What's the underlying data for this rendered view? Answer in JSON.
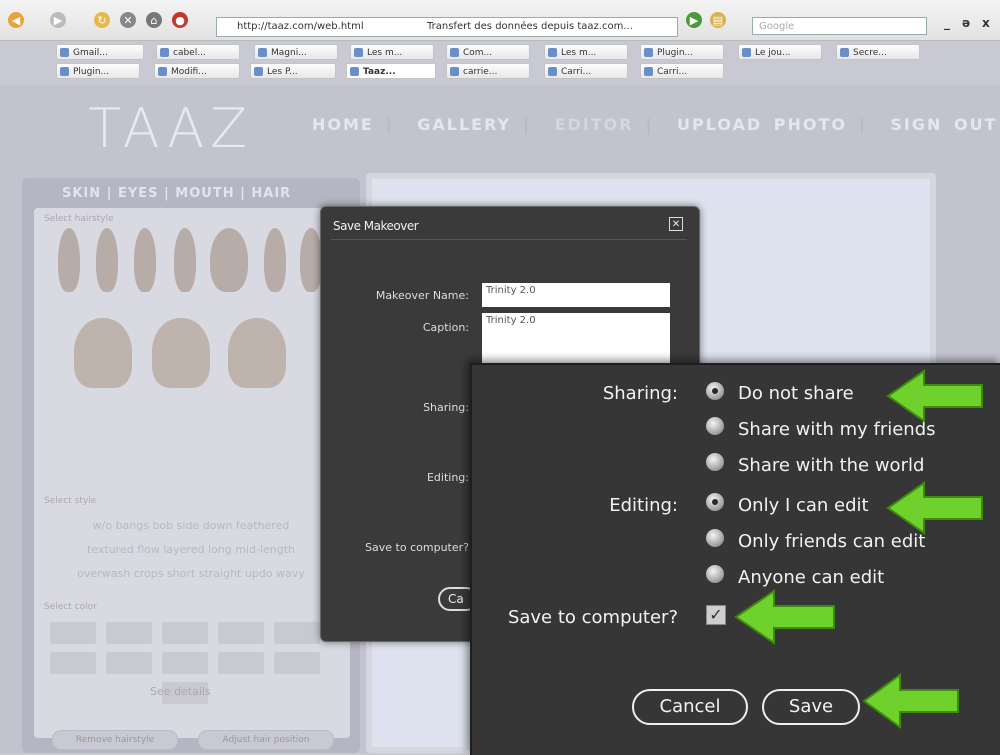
{
  "browser": {
    "url": "http://taaz.com/web.html",
    "status": "Transfert des données depuis taaz.com...",
    "search_placeholder": "Google",
    "win_min": "_",
    "win_max": "ə",
    "win_close": "x",
    "tabs_row1": [
      "Gmail...",
      "cabel...",
      "Magni...",
      "Les m...",
      "Com...",
      "Les m...",
      "Plugin...",
      "Le jou...",
      "Secre..."
    ],
    "tabs_row2": [
      "Plugin...",
      "Modifi...",
      "Les P...",
      "Taaz...",
      "carrie...",
      "Carri...",
      "Carri..."
    ]
  },
  "site": {
    "logo": "TAAZ",
    "nav": [
      "HOME",
      "GALLERY",
      "EDITOR",
      "UPLOAD PHOTO",
      "SIGN OUT"
    ],
    "subtabs": "SKIN | EYES | MOUTH | HAIR",
    "select_hairstyle": "Select hairstyle",
    "select_style": "Select style",
    "style_line1": "w/o bangs   bob   side   down   feathered",
    "style_line2": "textured   flow   layered   long   mid-length",
    "style_line3": "overwash   crops   short   straight   updo   wavy",
    "select_color": "Select color",
    "remove_btn": "Remove hairstyle",
    "adjust_btn": "Adjust hair position",
    "see_results": "See details"
  },
  "dialog": {
    "title": "Save Makeover",
    "close": "✕",
    "name_label": "Makeover Name:",
    "name_value": "Trinity 2.0",
    "caption_label": "Caption:",
    "caption_value": "Trinity 2.0",
    "sharing_label": "Sharing:",
    "editing_label": "Editing:",
    "save_label": "Save to computer?",
    "cancel_partial": "Ca"
  },
  "zoom": {
    "sharing_label": "Sharing:",
    "sharing_options": [
      "Do not share",
      "Share with my friends",
      "Share with the world"
    ],
    "sharing_selected": 0,
    "editing_label": "Editing:",
    "editing_options": [
      "Only I can edit",
      "Only friends can edit",
      "Anyone can edit"
    ],
    "editing_selected": 0,
    "save_label": "Save to computer?",
    "save_checked": true,
    "check_mark": "✓",
    "cancel": "Cancel",
    "save": "Save"
  },
  "colors": {
    "arrow_green": "#6fd12b",
    "dialog_bg": "#3a3a3a",
    "site_bg": "#c3c3cf"
  }
}
